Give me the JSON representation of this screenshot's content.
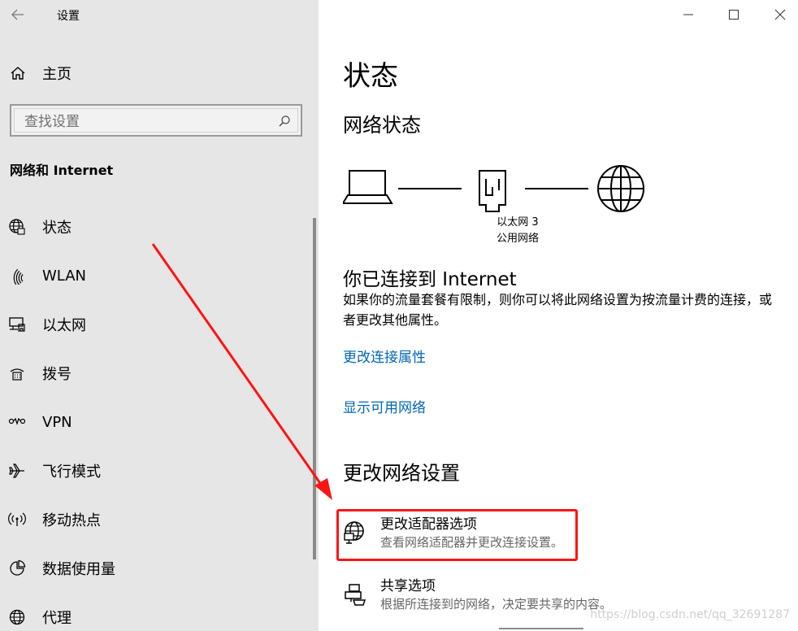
{
  "window": {
    "title": "设置",
    "controls": [
      "minimize",
      "maximize",
      "close"
    ]
  },
  "sidebar": {
    "home_label": "主页",
    "search_placeholder": "查找设置",
    "section_title": "网络和 Internet",
    "items": [
      {
        "label": "状态",
        "icon": "globe-status-icon"
      },
      {
        "label": "WLAN",
        "icon": "wifi-icon"
      },
      {
        "label": "以太网",
        "icon": "ethernet-icon"
      },
      {
        "label": "拨号",
        "icon": "dialup-icon"
      },
      {
        "label": "VPN",
        "icon": "vpn-icon"
      },
      {
        "label": "飞行模式",
        "icon": "airplane-icon"
      },
      {
        "label": "移动热点",
        "icon": "hotspot-icon"
      },
      {
        "label": "数据使用量",
        "icon": "data-usage-icon"
      },
      {
        "label": "代理",
        "icon": "proxy-globe-icon"
      }
    ]
  },
  "main": {
    "page_title": "状态",
    "network_status_heading": "网络状态",
    "adapter_name": "以太网 3",
    "adapter_network_type": "公用网络",
    "connected_heading": "你已连接到 Internet",
    "connected_description": "如果你的流量套餐有限制，则你可以将此网络设置为按流量计费的连接，或者更改其他属性。",
    "link_change_connection_properties": "更改连接属性",
    "link_show_available_networks": "显示可用网络",
    "change_settings_heading": "更改网络设置",
    "options": [
      {
        "title": "更改适配器选项",
        "subtitle": "查看网络适配器并更改连接设置。",
        "icon": "adapter-globe-icon"
      },
      {
        "title": "共享选项",
        "subtitle": "根据所连接到的网络，决定要共享的内容。",
        "icon": "sharing-icon"
      }
    ]
  },
  "watermark": "https://blog.csdn.net/qq_32691287",
  "colors": {
    "sidebar_bg": "#e6e6e6",
    "link": "#0066b4",
    "highlight_border": "#ff1414",
    "annotation_arrow": "#ff1414"
  }
}
